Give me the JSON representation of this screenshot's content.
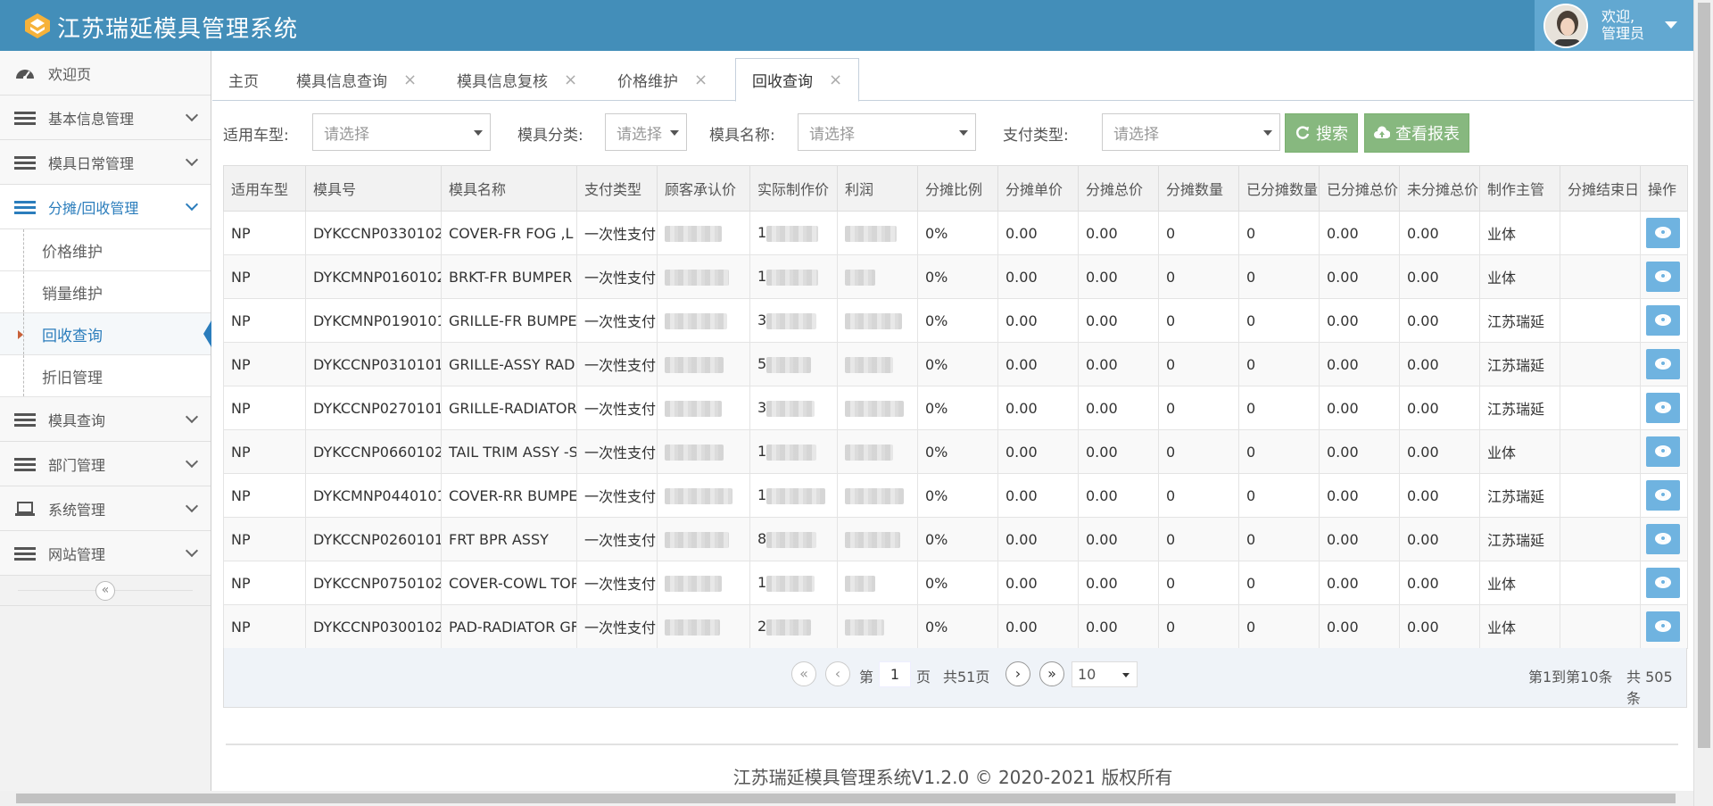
{
  "app": {
    "title": "江苏瑞延模具管理系统"
  },
  "user": {
    "welcome": "欢迎,",
    "name": "管理员"
  },
  "sidebar": {
    "items": [
      {
        "label": "欢迎页"
      },
      {
        "label": "基本信息管理"
      },
      {
        "label": "模具日常管理"
      },
      {
        "label": "分摊/回收管理"
      },
      {
        "label": "模具查询"
      },
      {
        "label": "部门管理"
      },
      {
        "label": "系统管理"
      },
      {
        "label": "网站管理"
      }
    ],
    "subitems": [
      {
        "label": "价格维护"
      },
      {
        "label": "销量维护"
      },
      {
        "label": "回收查询"
      },
      {
        "label": "折旧管理"
      }
    ],
    "collapse": "«"
  },
  "tabs": [
    {
      "label": "主页"
    },
    {
      "label": "模具信息查询"
    },
    {
      "label": "模具信息复核"
    },
    {
      "label": "价格维护"
    },
    {
      "label": "回收查询"
    }
  ],
  "filters": {
    "vehicle_label": "适用车型:",
    "category_label": "模具分类:",
    "name_label": "模具名称:",
    "pay_label": "支付类型:",
    "placeholder": "请选择",
    "search": "搜索",
    "report": "查看报表"
  },
  "table": {
    "headers": [
      "适用车型",
      "模具号",
      "模具名称",
      "支付类型",
      "顾客承认价",
      "实际制作价",
      "利润",
      "分摊比例",
      "分摊单价",
      "分摊总价",
      "分摊数量",
      "已分摊数量",
      "已分摊总价",
      "未分摊总价",
      "制作主管",
      "分摊结束日",
      "操作"
    ],
    "rows": [
      {
        "car": "NP",
        "code": "DYKCCNP0330102",
        "name": "COVER-FR FOG ,L",
        "pay": "一次性支付",
        "actual_prefix": "1",
        "ratio": "0%",
        "unit": "0.00",
        "total": "0.00",
        "qty": "0",
        "done_qty": "0",
        "done_total": "0.00",
        "remain": "0.00",
        "owner": "业体"
      },
      {
        "car": "NP",
        "code": "DYKCMNP0160102",
        "name": "BRKT-FR BUMPER",
        "pay": "一次性支付",
        "actual_prefix": "1",
        "ratio": "0%",
        "unit": "0.00",
        "total": "0.00",
        "qty": "0",
        "done_qty": "0",
        "done_total": "0.00",
        "remain": "0.00",
        "owner": "业体"
      },
      {
        "car": "NP",
        "code": "DYKCMNP0190101",
        "name": "GRILLE-FR BUMPE",
        "pay": "一次性支付",
        "actual_prefix": "3",
        "ratio": "0%",
        "unit": "0.00",
        "total": "0.00",
        "qty": "0",
        "done_qty": "0",
        "done_total": "0.00",
        "remain": "0.00",
        "owner": "江苏瑞延"
      },
      {
        "car": "NP",
        "code": "DYKCCNP0310101",
        "name": "GRILLE-ASSY RAD",
        "pay": "一次性支付",
        "actual_prefix": "5",
        "ratio": "0%",
        "unit": "0.00",
        "total": "0.00",
        "qty": "0",
        "done_qty": "0",
        "done_total": "0.00",
        "remain": "0.00",
        "owner": "江苏瑞延"
      },
      {
        "car": "NP",
        "code": "DYKCCNP0270101",
        "name": "GRILLE-RADIATOR",
        "pay": "一次性支付",
        "actual_prefix": "3",
        "ratio": "0%",
        "unit": "0.00",
        "total": "0.00",
        "qty": "0",
        "done_qty": "0",
        "done_total": "0.00",
        "remain": "0.00",
        "owner": "江苏瑞延"
      },
      {
        "car": "NP",
        "code": "DYKCCNP0660102",
        "name": "TAIL TRIM ASSY -S",
        "pay": "一次性支付",
        "actual_prefix": "1",
        "ratio": "0%",
        "unit": "0.00",
        "total": "0.00",
        "qty": "0",
        "done_qty": "0",
        "done_total": "0.00",
        "remain": "0.00",
        "owner": "业体"
      },
      {
        "car": "NP",
        "code": "DYKCMNP0440101",
        "name": "COVER-RR BUMPE",
        "pay": "一次性支付",
        "actual_prefix": "1",
        "ratio": "0%",
        "unit": "0.00",
        "total": "0.00",
        "qty": "0",
        "done_qty": "0",
        "done_total": "0.00",
        "remain": "0.00",
        "owner": "江苏瑞延"
      },
      {
        "car": "NP",
        "code": "DYKCCNP0260101",
        "name": "FRT BPR ASSY",
        "pay": "一次性支付",
        "actual_prefix": "8",
        "ratio": "0%",
        "unit": "0.00",
        "total": "0.00",
        "qty": "0",
        "done_qty": "0",
        "done_total": "0.00",
        "remain": "0.00",
        "owner": "江苏瑞延"
      },
      {
        "car": "NP",
        "code": "DYKCCNP0750102",
        "name": "COVER-COWL TOP",
        "pay": "一次性支付",
        "actual_prefix": "1",
        "ratio": "0%",
        "unit": "0.00",
        "total": "0.00",
        "qty": "0",
        "done_qty": "0",
        "done_total": "0.00",
        "remain": "0.00",
        "owner": "业体"
      },
      {
        "car": "NP",
        "code": "DYKCCNP0300102",
        "name": "PAD-RADIATOR GF",
        "pay": "一次性支付",
        "actual_prefix": "2",
        "ratio": "0%",
        "unit": "0.00",
        "total": "0.00",
        "qty": "0",
        "done_qty": "0",
        "done_total": "0.00",
        "remain": "0.00",
        "owner": "业体"
      }
    ]
  },
  "pager": {
    "first": "«",
    "prev": "‹",
    "page_prefix": "第",
    "page": "1",
    "page_suffix": "页",
    "total_pages": "共51页",
    "next": "›",
    "last": "»",
    "page_size": "10",
    "range": "第1到第10条",
    "total": "共 505 条"
  },
  "footer": {
    "text": "江苏瑞延模具管理系统V1.2.0 © 2020-2021 版权所有"
  },
  "colors": {
    "header": "#438eb9",
    "user_box": "#62a8d1",
    "active_nav": "#2b7dbc",
    "button_green": "#87b87f",
    "view_button": "#6fb3e0"
  }
}
